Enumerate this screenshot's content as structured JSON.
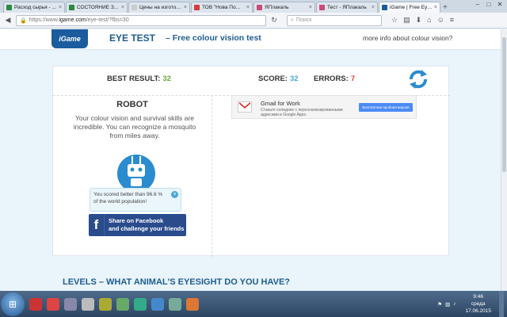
{
  "browser": {
    "tabs": [
      {
        "label": "Расход сырья - ...",
        "favicon_color": "#2b8a3e",
        "active": false
      },
      {
        "label": "СОСТОЯНИЕ З...",
        "favicon_color": "#2b8a3e",
        "active": false
      },
      {
        "label": "Цены на изготовле...",
        "favicon_color": "#cccccc",
        "active": false
      },
      {
        "label": "ТОВ \"Нова По...",
        "favicon_color": "#d93a3a",
        "active": false
      },
      {
        "label": "ЯПлакаль",
        "favicon_color": "#c84b7a",
        "active": false
      },
      {
        "label": "Тест - ЯПлакаль",
        "favicon_color": "#c84b7a",
        "active": false
      },
      {
        "label": "iGame | Free Eye Test",
        "favicon_color": "#1b5c9e",
        "active": true
      }
    ],
    "new_tab": "+",
    "url_prefix": "https://www.",
    "url_domain": "igame.com",
    "url_path": "/eye-test/?fbs=30",
    "search_placeholder": "Поиск"
  },
  "header": {
    "logo": "iGame",
    "title": "EYE TEST",
    "subtitle": "– Free colour vision test",
    "more_info": "more info about colour vision?"
  },
  "stats": {
    "best_label": "BEST RESULT:",
    "best_value": "32",
    "score_label": "SCORE:",
    "score_value": "32",
    "errors_label": "ERRORS:",
    "errors_value": "7"
  },
  "result": {
    "rank": "ROBOT",
    "description": "Your colour vision and survival skills are incredible. You can recognize a mosquito from miles away.",
    "tooltip": "You scored better than 96.6 % of the world population!",
    "tooltip_close": "×",
    "share_line1": "Share on Facebook",
    "share_line2": "and challenge your friends",
    "fb_glyph": "f"
  },
  "ad": {
    "title": "Gmail for Work",
    "text": "Станьте солиднее с персонализированными адресами в Google Apps.",
    "button": "Бесплатная пробная версия"
  },
  "levels_heading": "LEVELS – WHAT ANIMAL'S EYESIGHT DO YOU HAVE?",
  "taskbar": {
    "time": "9:46",
    "day": "среда",
    "date": "17.06.2015",
    "app_colors": [
      "#c33",
      "#d44",
      "#88a",
      "#bbb",
      "#aa3",
      "#6a6",
      "#3a8",
      "#48c",
      "#7a9",
      "#d73"
    ]
  },
  "colors": {
    "accent": "#1e5d8f",
    "best": "#6aa93b",
    "score": "#4aa8d8",
    "errors": "#d0473c",
    "facebook": "#2a4c8c"
  }
}
